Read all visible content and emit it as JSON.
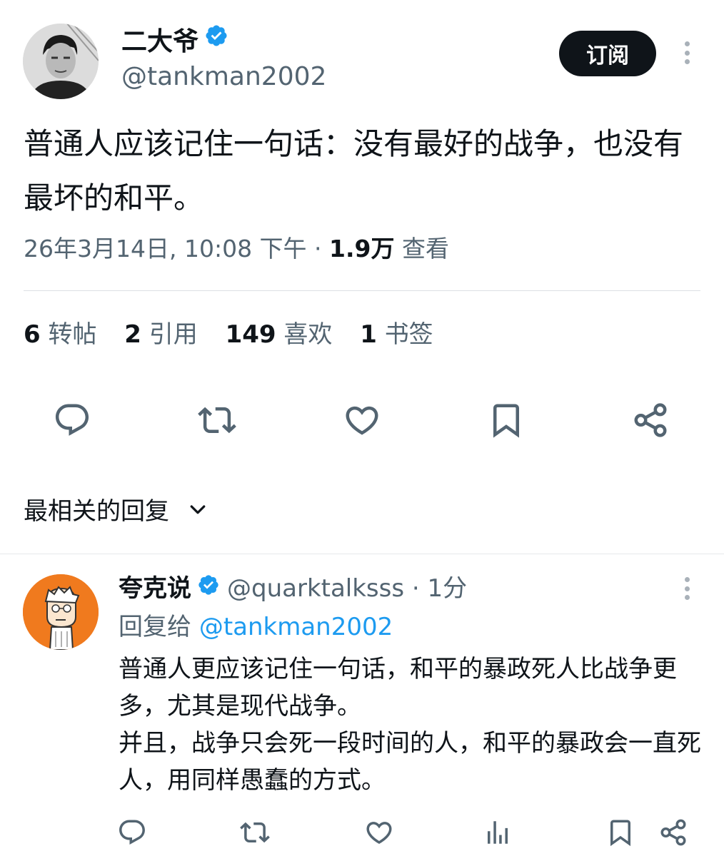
{
  "post": {
    "author": {
      "display_name": "二大爷",
      "handle": "@tankman2002",
      "verified": true
    },
    "subscribe_label": "订阅",
    "text": "普通人应该记住一句话：没有最好的战争，也没有最坏的和平。",
    "timestamp": "26年3月14日, 10:08 下午",
    "separator": " · ",
    "views_count": "1.9万",
    "views_label": "查看",
    "stats": [
      {
        "count": "6",
        "label": "转帖"
      },
      {
        "count": "2",
        "label": "引用"
      },
      {
        "count": "149",
        "label": "喜欢"
      },
      {
        "count": "1",
        "label": "书签"
      }
    ],
    "actions": [
      "reply-icon",
      "repost-icon",
      "like-icon",
      "bookmark-icon",
      "share-icon"
    ]
  },
  "replies_sort": {
    "label": "最相关的回复"
  },
  "reply": {
    "display_name": "夸克说",
    "verified": true,
    "handle": "@quarktalksss",
    "time": " · 1分",
    "reply_to_prefix": "回复给 ",
    "reply_to_handle": "@tankman2002",
    "paragraphs": [
      "普通人更应该记住一句话，和平的暴政死人比战争更多，尤其是现代战争。",
      "并且，战争只会死一段时间的人，和平的暴政会一直死人，用同样愚蠢的方式。"
    ],
    "actions": [
      "reply-icon",
      "repost-icon",
      "like-icon",
      "views-icon",
      "bookmark-icon",
      "share-icon"
    ]
  },
  "colors": {
    "text_primary": "#0f1419",
    "text_secondary": "#536471",
    "accent": "#1d9bf0",
    "verified": "#1d9bf0",
    "button_bg": "#0f1419",
    "avatar_reply_bg": "#f07a1e"
  }
}
